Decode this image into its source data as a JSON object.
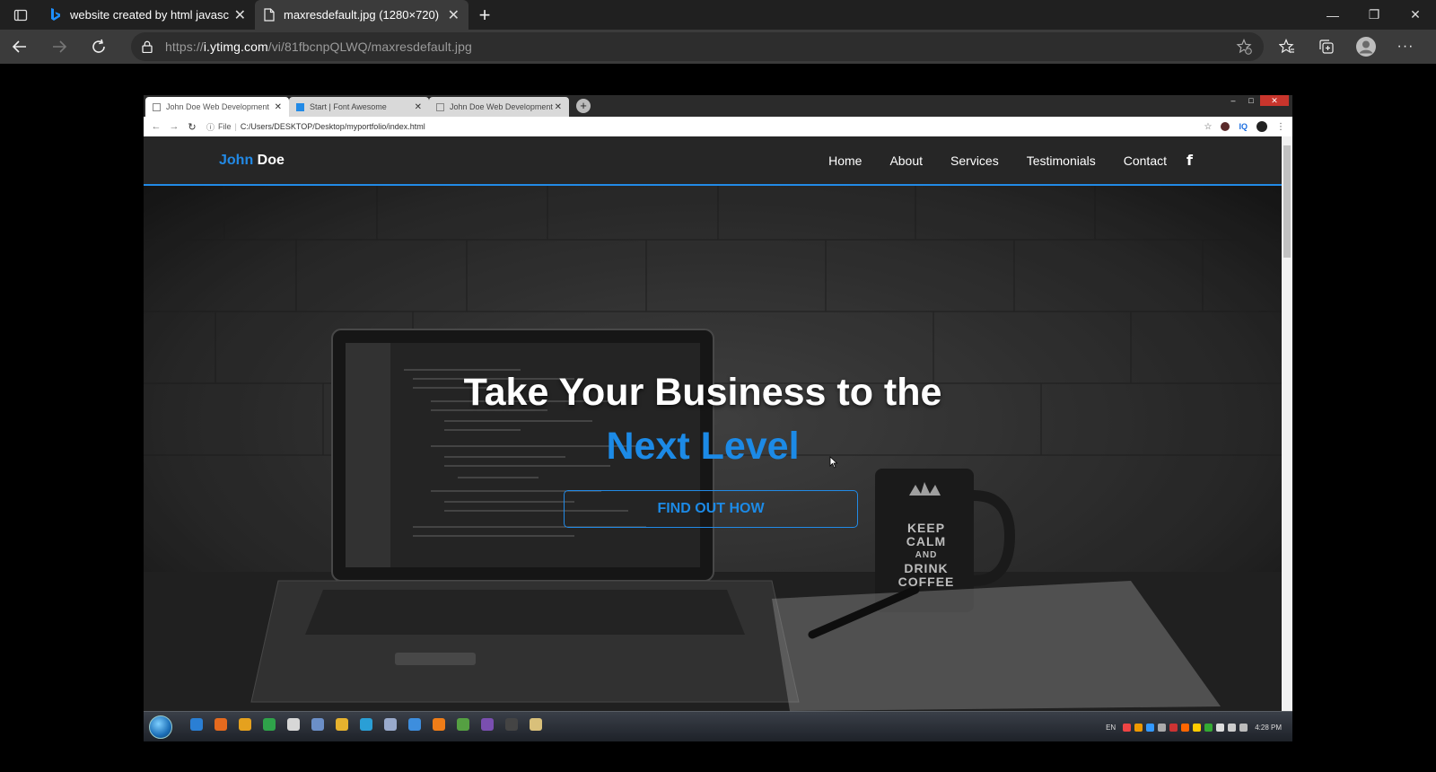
{
  "outer_browser": {
    "tabs": [
      {
        "title": "website created by html javascrip",
        "active": false
      },
      {
        "title": "maxresdefault.jpg (1280×720)",
        "active": true
      }
    ],
    "url_prefix": "https://",
    "url_host": "i.ytimg.com",
    "url_path": "/vi/81fbcnpQLWQ/maxresdefault.jpg"
  },
  "inner_browser": {
    "tabs": [
      {
        "title": "John Doe Web Development"
      },
      {
        "title": "Start | Font Awesome"
      },
      {
        "title": "John Doe Web Development"
      }
    ],
    "url_label": "File",
    "url": "C:/Users/DESKTOP/Desktop/myportfolio/index.html"
  },
  "site": {
    "logo_first": "John",
    "logo_last": "Doe",
    "menu": [
      "Home",
      "About",
      "Services",
      "Testimonials",
      "Contact"
    ],
    "social_icon": "f",
    "hero_title": "Take Your Business to the",
    "hero_subtitle": "Next Level",
    "cta_label": "FIND OUT HOW",
    "mug_text": [
      "KEEP",
      "CALM",
      "AND",
      "DRINK",
      "COFFEE"
    ]
  },
  "taskbar": {
    "language": "EN",
    "clock": "4:28 PM"
  },
  "colors": {
    "accent_blue": "#228ae6",
    "nav_bg": "#262626",
    "chrome_dark": "#202020"
  }
}
